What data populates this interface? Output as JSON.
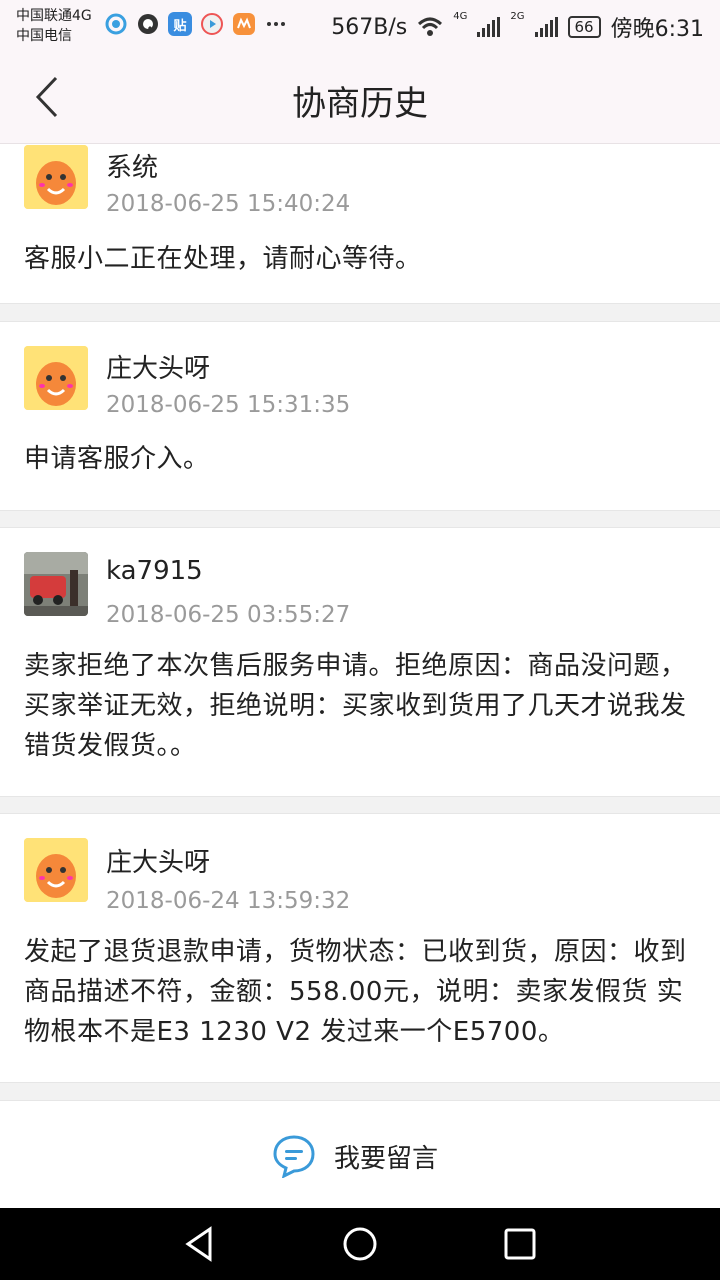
{
  "status_bar": {
    "carrier_1": "中国联通4G",
    "carrier_2": "中国电信",
    "app_icon_label": "贴",
    "net_speed": "567B/s",
    "net_4g": "4G",
    "net_2g": "2G",
    "battery": "66",
    "time": "傍晚6:31"
  },
  "header": {
    "title": "协商历史"
  },
  "entries": [
    {
      "user": "系统",
      "time": "2018-06-25 15:40:24",
      "message": "客服小二正在处理，请耐心等待。",
      "avatar": "mascot-avatar"
    },
    {
      "user": "庄大头呀",
      "time": "2018-06-25 15:31:35",
      "message": "申请客服介入。",
      "avatar": "mascot-avatar"
    },
    {
      "user": "ka7915",
      "time": "2018-06-25 03:55:27",
      "message": "卖家拒绝了本次售后服务申请。拒绝原因：商品没问题，买家举证无效，拒绝说明：买家收到货用了几天才说我发错货发假货。。",
      "avatar": "photo-avatar"
    },
    {
      "user": "庄大头呀",
      "time": "2018-06-24 13:59:32",
      "message": "发起了退货退款申请，货物状态：已收到货，原因：收到商品描述不符，金额：558.00元，说明：卖家发假货 实物根本不是E3 1230 V2 发过来一个E5700。",
      "avatar": "mascot-avatar"
    }
  ],
  "footer": {
    "comment_label": "我要留言",
    "comment_icon": "speech-bubble-icon"
  },
  "colors": {
    "accent": "#3a9ad9",
    "timestamp": "#9a9a9a",
    "header_bg": "#fbf6f9"
  }
}
